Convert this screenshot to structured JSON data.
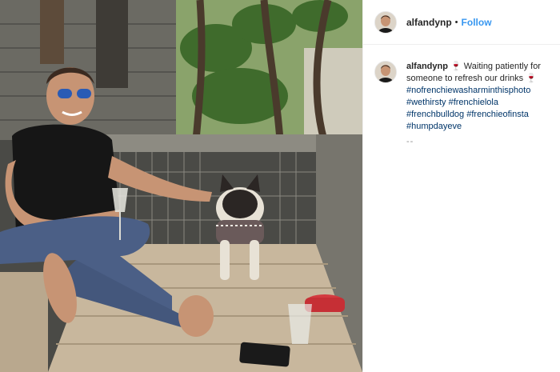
{
  "post": {
    "username": "alfandynp",
    "separator": "•",
    "follow_label": "Follow",
    "caption": {
      "username": "alfandynp",
      "emoji": "🍷",
      "text": "Waiting patiently for someone to refresh our drinks",
      "hashtags": [
        "#nofrenchiewasharminthisphoto",
        "#wethirsty",
        "#frenchielola",
        "#frenchbulldog",
        "#frenchieofinsta",
        "#humpdayeve"
      ],
      "more": "--"
    }
  },
  "colors": {
    "accent": "#3897f0",
    "hashtag": "#003569",
    "border": "#efefef"
  },
  "icons": {
    "avatar": "user-avatar-photo",
    "emoji": "wine-glass-emoji"
  }
}
